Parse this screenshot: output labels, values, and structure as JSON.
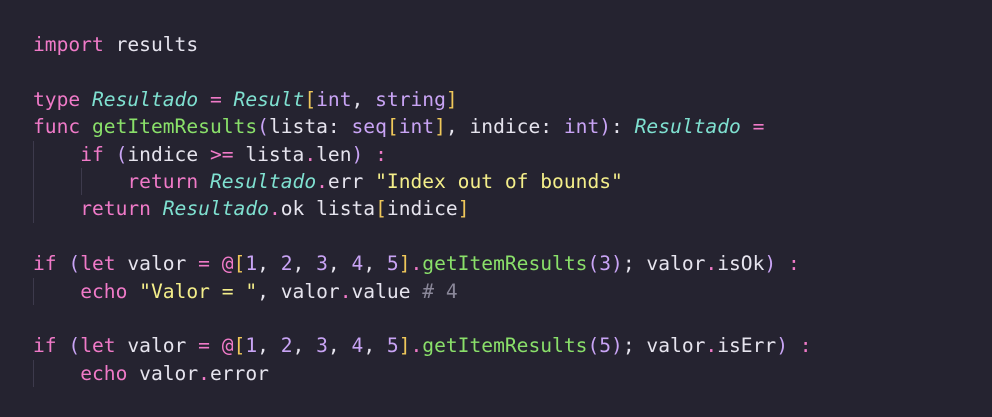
{
  "editor": {
    "background": "#252330",
    "palette": {
      "keyword": "#f07ac8",
      "type": "#7fe0d0",
      "function": "#8ae06a",
      "string": "#f4ee8a",
      "number": "#c9a4f5",
      "bracket": "#f0c85a",
      "text": "#e6e4ee",
      "comment": "#8a8799"
    },
    "lines": [
      {
        "indent": 0,
        "tokens": [
          {
            "t": "import",
            "k": "keyword"
          },
          {
            "t": " results",
            "k": "plain"
          }
        ]
      },
      {
        "indent": 0,
        "tokens": []
      },
      {
        "indent": 0,
        "tokens": [
          {
            "t": "type",
            "k": "keyword"
          },
          {
            "t": " ",
            "k": "plain"
          },
          {
            "t": "Resultado",
            "k": "type"
          },
          {
            "t": " ",
            "k": "plain"
          },
          {
            "t": "=",
            "k": "operator"
          },
          {
            "t": " ",
            "k": "plain"
          },
          {
            "t": "Result",
            "k": "type"
          },
          {
            "t": "[",
            "k": "bracket"
          },
          {
            "t": "int",
            "k": "builtin"
          },
          {
            "t": ", ",
            "k": "punct"
          },
          {
            "t": "string",
            "k": "builtin"
          },
          {
            "t": "]",
            "k": "bracket"
          }
        ]
      },
      {
        "indent": 0,
        "tokens": [
          {
            "t": "func",
            "k": "keyword"
          },
          {
            "t": " ",
            "k": "plain"
          },
          {
            "t": "getItemResults",
            "k": "func"
          },
          {
            "t": "(",
            "k": "paren"
          },
          {
            "t": "lista",
            "k": "plain"
          },
          {
            "t": ":",
            "k": "punct"
          },
          {
            "t": " ",
            "k": "plain"
          },
          {
            "t": "seq",
            "k": "builtin"
          },
          {
            "t": "[",
            "k": "bracket"
          },
          {
            "t": "int",
            "k": "builtin"
          },
          {
            "t": "]",
            "k": "bracket"
          },
          {
            "t": ", ",
            "k": "punct"
          },
          {
            "t": "indice",
            "k": "plain"
          },
          {
            "t": ":",
            "k": "punct"
          },
          {
            "t": " ",
            "k": "plain"
          },
          {
            "t": "int",
            "k": "builtin"
          },
          {
            "t": ")",
            "k": "paren"
          },
          {
            "t": ":",
            "k": "punct"
          },
          {
            "t": " ",
            "k": "plain"
          },
          {
            "t": "Resultado",
            "k": "type"
          },
          {
            "t": " ",
            "k": "plain"
          },
          {
            "t": "=",
            "k": "operator"
          }
        ]
      },
      {
        "indent": 1,
        "tokens": [
          {
            "t": "if",
            "k": "keyword"
          },
          {
            "t": " ",
            "k": "plain"
          },
          {
            "t": "(",
            "k": "paren"
          },
          {
            "t": "indice",
            "k": "plain"
          },
          {
            "t": " ",
            "k": "plain"
          },
          {
            "t": ">=",
            "k": "operator"
          },
          {
            "t": " lista",
            "k": "plain"
          },
          {
            "t": ".",
            "k": "operator"
          },
          {
            "t": "len",
            "k": "prop"
          },
          {
            "t": ")",
            "k": "paren"
          },
          {
            "t": " ",
            "k": "plain"
          },
          {
            "t": ":",
            "k": "operator"
          }
        ]
      },
      {
        "indent": 2,
        "tokens": [
          {
            "t": "return",
            "k": "keyword"
          },
          {
            "t": " ",
            "k": "plain"
          },
          {
            "t": "Resultado",
            "k": "type"
          },
          {
            "t": ".",
            "k": "operator"
          },
          {
            "t": "err",
            "k": "prop"
          },
          {
            "t": " ",
            "k": "plain"
          },
          {
            "t": "\"Index out of bounds\"",
            "k": "string"
          }
        ]
      },
      {
        "indent": 1,
        "tokens": [
          {
            "t": "return",
            "k": "keyword"
          },
          {
            "t": " ",
            "k": "plain"
          },
          {
            "t": "Resultado",
            "k": "type"
          },
          {
            "t": ".",
            "k": "operator"
          },
          {
            "t": "ok",
            "k": "prop"
          },
          {
            "t": " lista",
            "k": "plain"
          },
          {
            "t": "[",
            "k": "bracket"
          },
          {
            "t": "indice",
            "k": "plain"
          },
          {
            "t": "]",
            "k": "bracket"
          }
        ]
      },
      {
        "indent": 0,
        "tokens": []
      },
      {
        "indent": 0,
        "tokens": [
          {
            "t": "if",
            "k": "keyword"
          },
          {
            "t": " ",
            "k": "plain"
          },
          {
            "t": "(",
            "k": "paren"
          },
          {
            "t": "let",
            "k": "keyword"
          },
          {
            "t": " valor ",
            "k": "plain"
          },
          {
            "t": "=",
            "k": "operator"
          },
          {
            "t": " ",
            "k": "plain"
          },
          {
            "t": "@",
            "k": "operator"
          },
          {
            "t": "[",
            "k": "bracket"
          },
          {
            "t": "1",
            "k": "number"
          },
          {
            "t": ", ",
            "k": "punct"
          },
          {
            "t": "2",
            "k": "number"
          },
          {
            "t": ", ",
            "k": "punct"
          },
          {
            "t": "3",
            "k": "number"
          },
          {
            "t": ", ",
            "k": "punct"
          },
          {
            "t": "4",
            "k": "number"
          },
          {
            "t": ", ",
            "k": "punct"
          },
          {
            "t": "5",
            "k": "number"
          },
          {
            "t": "]",
            "k": "bracket"
          },
          {
            "t": ".",
            "k": "operator"
          },
          {
            "t": "getItemResults",
            "k": "func"
          },
          {
            "t": "(",
            "k": "paren"
          },
          {
            "t": "3",
            "k": "number"
          },
          {
            "t": ")",
            "k": "paren"
          },
          {
            "t": "; valor",
            "k": "plain"
          },
          {
            "t": ".",
            "k": "operator"
          },
          {
            "t": "isOk",
            "k": "prop"
          },
          {
            "t": ")",
            "k": "paren"
          },
          {
            "t": " ",
            "k": "plain"
          },
          {
            "t": ":",
            "k": "operator"
          }
        ]
      },
      {
        "indent": 1,
        "tokens": [
          {
            "t": "echo",
            "k": "keyword"
          },
          {
            "t": " ",
            "k": "plain"
          },
          {
            "t": "\"Valor = \"",
            "k": "string"
          },
          {
            "t": ", valor",
            "k": "plain"
          },
          {
            "t": ".",
            "k": "operator"
          },
          {
            "t": "value",
            "k": "prop"
          },
          {
            "t": " ",
            "k": "plain"
          },
          {
            "t": "# 4",
            "k": "comment"
          }
        ]
      },
      {
        "indent": 0,
        "tokens": []
      },
      {
        "indent": 0,
        "tokens": [
          {
            "t": "if",
            "k": "keyword"
          },
          {
            "t": " ",
            "k": "plain"
          },
          {
            "t": "(",
            "k": "paren"
          },
          {
            "t": "let",
            "k": "keyword"
          },
          {
            "t": " valor ",
            "k": "plain"
          },
          {
            "t": "=",
            "k": "operator"
          },
          {
            "t": " ",
            "k": "plain"
          },
          {
            "t": "@",
            "k": "operator"
          },
          {
            "t": "[",
            "k": "bracket"
          },
          {
            "t": "1",
            "k": "number"
          },
          {
            "t": ", ",
            "k": "punct"
          },
          {
            "t": "2",
            "k": "number"
          },
          {
            "t": ", ",
            "k": "punct"
          },
          {
            "t": "3",
            "k": "number"
          },
          {
            "t": ", ",
            "k": "punct"
          },
          {
            "t": "4",
            "k": "number"
          },
          {
            "t": ", ",
            "k": "punct"
          },
          {
            "t": "5",
            "k": "number"
          },
          {
            "t": "]",
            "k": "bracket"
          },
          {
            "t": ".",
            "k": "operator"
          },
          {
            "t": "getItemResults",
            "k": "func"
          },
          {
            "t": "(",
            "k": "paren"
          },
          {
            "t": "5",
            "k": "number"
          },
          {
            "t": ")",
            "k": "paren"
          },
          {
            "t": "; valor",
            "k": "plain"
          },
          {
            "t": ".",
            "k": "operator"
          },
          {
            "t": "isErr",
            "k": "prop"
          },
          {
            "t": ")",
            "k": "paren"
          },
          {
            "t": " ",
            "k": "plain"
          },
          {
            "t": ":",
            "k": "operator"
          }
        ]
      },
      {
        "indent": 1,
        "tokens": [
          {
            "t": "echo",
            "k": "keyword"
          },
          {
            "t": " valor",
            "k": "plain"
          },
          {
            "t": ".",
            "k": "operator"
          },
          {
            "t": "error",
            "k": "prop"
          }
        ]
      }
    ]
  }
}
